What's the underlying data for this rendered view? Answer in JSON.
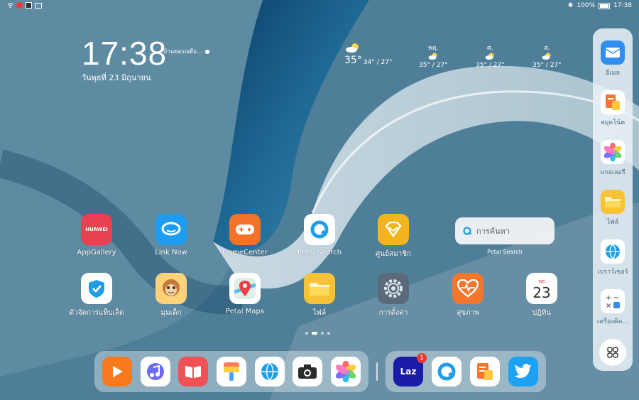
{
  "status_bar": {
    "battery": "100%",
    "time": "17:38"
  },
  "clock": {
    "time": "17:38",
    "location": "บ้านซอรณดีย...",
    "date": "วันพุธที่ 23 มิถุนายน"
  },
  "weather": {
    "today": {
      "temp": "35°",
      "range": "34° / 27°"
    },
    "days": [
      {
        "day": "พฤ.",
        "range": "35° / 27°"
      },
      {
        "day": "ศ.",
        "range": "35° / 27°"
      },
      {
        "day": "ส.",
        "range": "35° / 27°"
      }
    ]
  },
  "home": {
    "row1": [
      {
        "label": "AppGallery",
        "icon": "appgallery-icon",
        "color": "#e8414f"
      },
      {
        "label": "Link Now",
        "icon": "linknow-icon",
        "color": "#1e9cf0"
      },
      {
        "label": "GameCenter",
        "icon": "gamecenter-icon",
        "color": "#f4732b"
      },
      {
        "label": "Petal Search",
        "icon": "petal-search-icon",
        "color": "#ffffff"
      },
      {
        "label": "ศูนย์สมาชิก",
        "icon": "member-center-icon",
        "color": "#f2b51e"
      }
    ],
    "row2": [
      {
        "label": "ตัวจัดการแท็บเล็ต",
        "icon": "tablet-manager-icon",
        "color": "#ffffff"
      },
      {
        "label": "มุมเด็ก",
        "icon": "kids-corner-icon",
        "color": "#ffd27a"
      },
      {
        "label": "Petal Maps",
        "icon": "petal-maps-icon",
        "color": "#ffffff"
      },
      {
        "label": "ไฟล์",
        "icon": "files-icon",
        "color": "#f7c236"
      },
      {
        "label": "การตั้งค่า",
        "icon": "settings-icon",
        "color": "#5b6a7a"
      },
      {
        "label": "สุขภาพ",
        "icon": "health-icon",
        "color": "#f5762c"
      },
      {
        "label": "ปฏิทิน",
        "icon": "calendar-icon",
        "color": "#ffffff",
        "weekday": "พุธ",
        "day": "23"
      }
    ],
    "search_widget": {
      "placeholder": "การค้นหา",
      "caption": "Petal Search"
    }
  },
  "dock_left": [
    {
      "icon": "video-icon",
      "color": "#f97a1c"
    },
    {
      "icon": "music-icon",
      "color": "#ffffff"
    },
    {
      "icon": "books-icon",
      "color": "#f05155"
    },
    {
      "icon": "themes-icon",
      "color": "#ffffff"
    },
    {
      "icon": "browser-icon",
      "color": "#ffffff"
    },
    {
      "icon": "camera-icon",
      "color": "#ffffff"
    },
    {
      "icon": "gallery-icon",
      "color": "#ffffff"
    }
  ],
  "dock_right": [
    {
      "icon": "lazada-icon",
      "color": "#1a1ca8",
      "badge": "1",
      "text": "Laz"
    },
    {
      "icon": "petal-search-icon",
      "color": "#ffffff"
    },
    {
      "icon": "notepad-icon",
      "color": "#ffffff"
    },
    {
      "icon": "twitter-icon",
      "color": "#1da1f2"
    }
  ],
  "side_dock": [
    {
      "label": "อีเมล",
      "icon": "email-icon",
      "color": "#2f8ef0"
    },
    {
      "label": "สมุดโน้ต",
      "icon": "notepad-icon",
      "color": "#ffffff"
    },
    {
      "label": "แกลเลอรี",
      "icon": "gallery-icon",
      "color": "#ffffff"
    },
    {
      "label": "ไฟล์",
      "icon": "files-icon",
      "color": "#f7c236"
    },
    {
      "label": "เบราว์เซอร์",
      "icon": "browser-icon",
      "color": "#ffffff"
    },
    {
      "label": "เครื่องคิด...",
      "icon": "calculator-icon",
      "color": "#ffffff"
    }
  ]
}
